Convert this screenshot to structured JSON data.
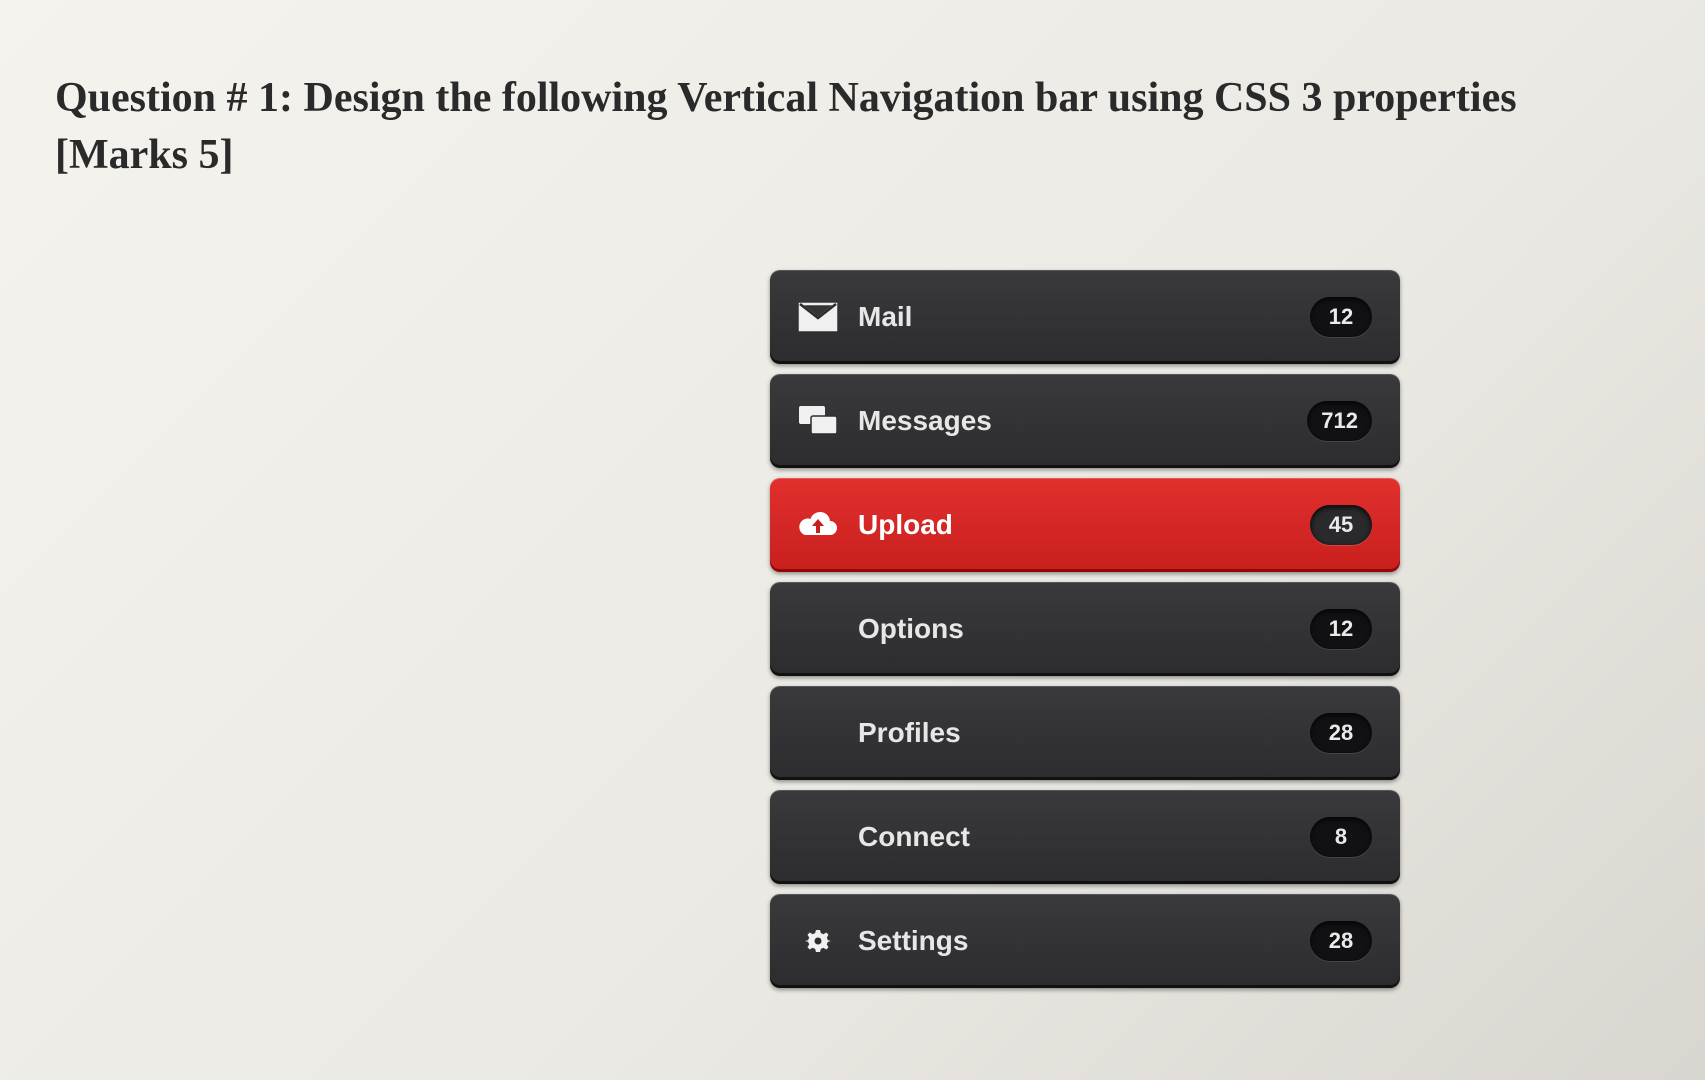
{
  "question": {
    "line1": "Question # 1: Design the following Vertical Navigation bar using CSS 3 properties",
    "line2": "[Marks 5]"
  },
  "nav": {
    "items": [
      {
        "label": "Mail",
        "count": "12",
        "icon": "mail",
        "active": false
      },
      {
        "label": "Messages",
        "count": "712",
        "icon": "messages",
        "active": false
      },
      {
        "label": "Upload",
        "count": "45",
        "icon": "upload",
        "active": true
      },
      {
        "label": "Options",
        "count": "12",
        "icon": "",
        "active": false
      },
      {
        "label": "Profiles",
        "count": "28",
        "icon": "",
        "active": false
      },
      {
        "label": "Connect",
        "count": "8",
        "icon": "",
        "active": false
      },
      {
        "label": "Settings",
        "count": "28",
        "icon": "gear",
        "active": false
      }
    ]
  }
}
